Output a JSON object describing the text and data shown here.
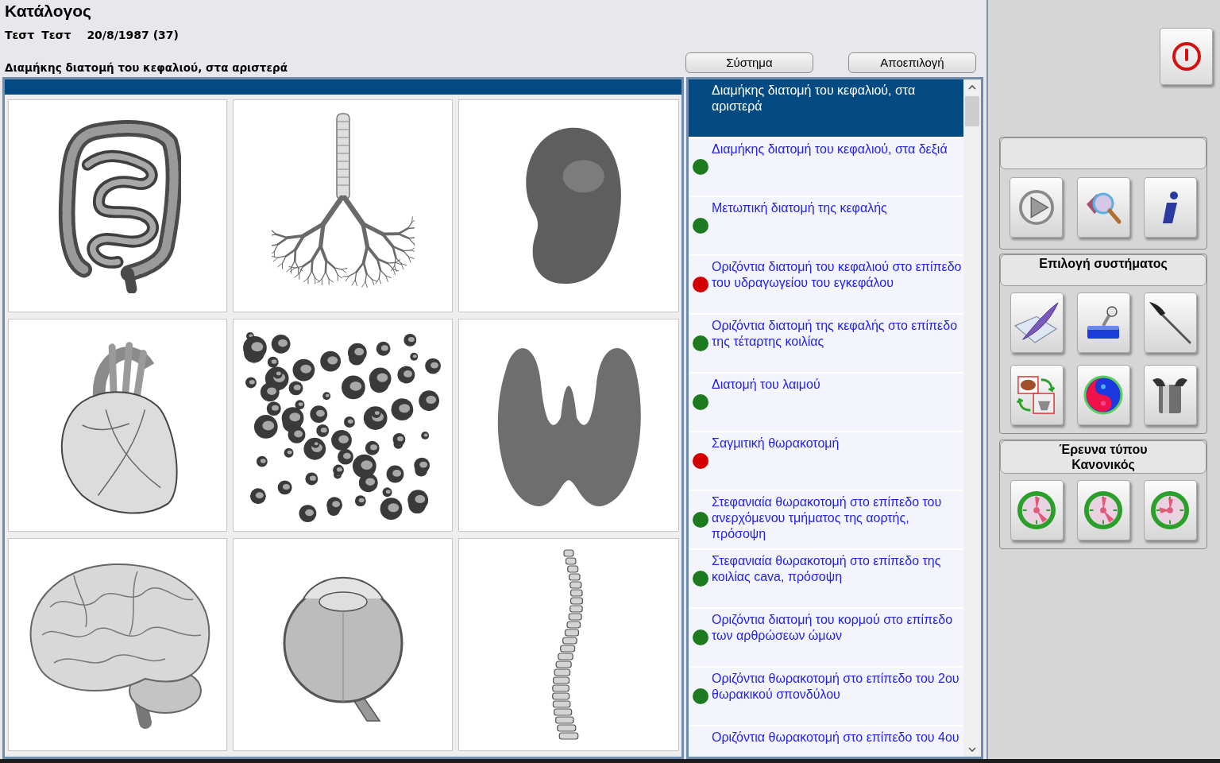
{
  "header": {
    "title": "Κατάλογος",
    "patient": {
      "first_name": "Τεστ",
      "last_name": "Τεστ",
      "birth_date": "20/8/1987 (37)"
    },
    "selected_view": "Διαμήκης διατομή του κεφαλιού, στα αριστερά"
  },
  "buttons": [
    "Σύστημα",
    "Αποεπιλογή"
  ],
  "views": [
    {
      "text": "Διαμήκης διατομή του κεφαλιού, στα αριστερά",
      "selected": true
    },
    {
      "text": "Διαμήκης διατομή του κεφαλιού, στα δεξιά",
      "selected": false,
      "color": "#1e7a1e"
    },
    {
      "text": "Μετωπική διατομή της κεφαλής",
      "selected": false,
      "color": "#1e7a1e"
    },
    {
      "text": "Οριζόντια διατομή του κεφαλιού στο επίπεδο του υδραγωγείου του εγκεφάλου",
      "selected": false,
      "color": "#d40000"
    },
    {
      "text": "Οριζόντια διατομή της κεφαλής στο επίπεδο της τέταρτης κοιλίας",
      "selected": false,
      "color": "#1e7a1e"
    },
    {
      "text": "Διατομή του λαιμού",
      "selected": false,
      "color": "#1e7a1e"
    },
    {
      "text": "Σαγμιτική θωρακοτομή",
      "selected": false,
      "color": "#d40000"
    },
    {
      "text": "Στεφανιαία θωρακοτομή στο επίπεδο του ανερχόμενου τμήματος της αορτής, πρόσοψη",
      "selected": false,
      "color": "#1e7a1e"
    },
    {
      "text": "Στεφανιαία θωρακοτομή στο επίπεδο της κοιλίας cava, πρόσοψη",
      "selected": false,
      "color": "#1e7a1e"
    },
    {
      "text": "Οριζόντια διατομή του κορμού στο επίπεδο των αρθρώσεων ώμων",
      "selected": false,
      "color": "#1e7a1e"
    },
    {
      "text": "Οριζόντια θωρακοτομή στο επίπεδο του 2ου θωρακικού σπονδύλου",
      "selected": false,
      "color": "#1e7a1e"
    },
    {
      "text": "Οριζόντια θωρακοτομή στο επίπεδο του 4ου",
      "selected": false
    }
  ],
  "side_panel": {
    "system_group": {
      "header": "Επιλογή συστήματος"
    },
    "exam_group": {
      "header_lines": [
        "Έρευνα τύπου",
        "Κανονικός"
      ]
    }
  }
}
